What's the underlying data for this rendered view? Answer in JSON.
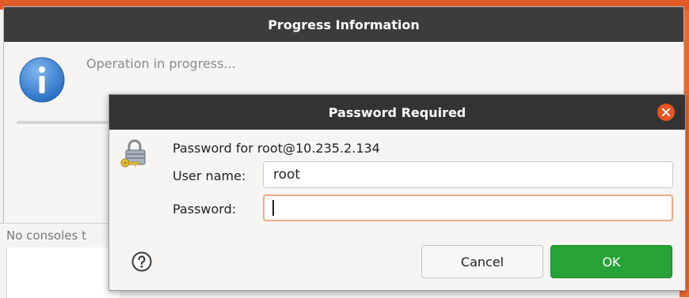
{
  "background": {
    "console_message": "No consoles t"
  },
  "progress_dialog": {
    "title": "Progress Information",
    "status": "Operation in progress...",
    "icon": "info-icon"
  },
  "password_dialog": {
    "title": "Password Required",
    "prompt": "Password for root@10.235.2.134",
    "username_label": "User name:",
    "username_value": "root",
    "password_label": "Password:",
    "password_value": "",
    "cancel_label": "Cancel",
    "ok_label": "OK",
    "icons": [
      "close-icon",
      "lock-key-icon",
      "help-icon"
    ]
  },
  "colors": {
    "accent": "#e95420",
    "ok_button": "#26a237",
    "title_bar": "#333333"
  }
}
